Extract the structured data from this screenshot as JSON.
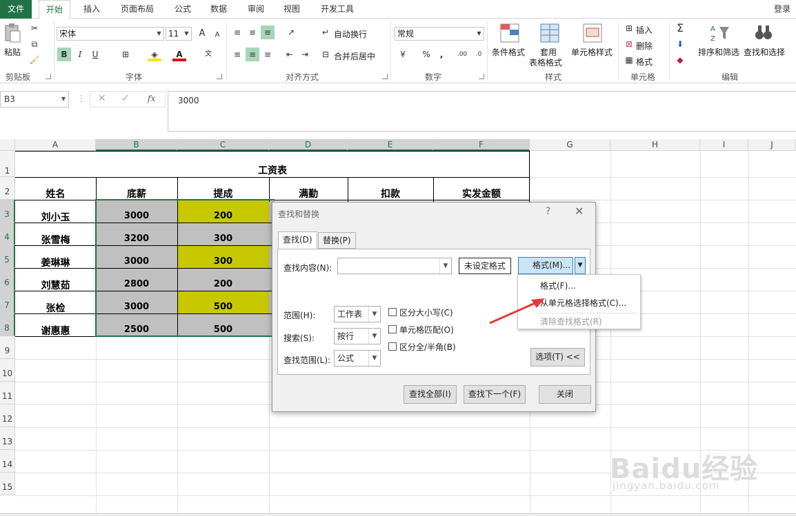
{
  "tabs": {
    "file": "文件",
    "items": [
      "开始",
      "插入",
      "页面布局",
      "公式",
      "数据",
      "审阅",
      "视图",
      "开发工具"
    ],
    "active": "开始",
    "login": "登录"
  },
  "ribbon": {
    "clipboard": {
      "paste": "粘贴",
      "label": "剪贴板"
    },
    "font": {
      "name": "宋体",
      "size": "11",
      "label": "字体",
      "bold": "B",
      "italic": "I",
      "underline": "U",
      "grow": "A",
      "shrink": "A"
    },
    "alignment": {
      "wrap": "自动换行",
      "merge": "合并后居中",
      "label": "对齐方式"
    },
    "number": {
      "format": "常规",
      "percent": "%",
      "comma": ",",
      "label": "数字"
    },
    "styles": {
      "conditional": "条件格式",
      "table": "套用",
      "table2": "表格格式",
      "cell": "单元格样式",
      "label": "样式"
    },
    "cells": {
      "insert": "插入",
      "delete": "删除",
      "format": "格式",
      "label": "单元格"
    },
    "editing": {
      "sort": "排序和筛选",
      "find": "查找和选择",
      "label": "编辑"
    }
  },
  "formula_bar": {
    "name_box": "B3",
    "fx": "fx",
    "content": "3000"
  },
  "sheet": {
    "columns": [
      "A",
      "B",
      "C",
      "D",
      "E",
      "F",
      "G",
      "H",
      "I",
      "J"
    ],
    "rows": [
      "1",
      "2",
      "3",
      "4",
      "5",
      "6",
      "7",
      "8",
      "9",
      "10",
      "11",
      "12",
      "13",
      "14",
      "15"
    ],
    "title": "工资表",
    "headers": [
      "姓名",
      "底薪",
      "提成",
      "满勤",
      "扣款",
      "实发金额"
    ],
    "data": [
      {
        "name": "刘小玉",
        "base": "3000",
        "bonus": "200"
      },
      {
        "name": "张雪梅",
        "base": "3200",
        "bonus": "300"
      },
      {
        "name": "姜琳琳",
        "base": "3000",
        "bonus": "300"
      },
      {
        "name": "刘慧茹",
        "base": "2800",
        "bonus": "200"
      },
      {
        "name": "张检",
        "base": "3000",
        "bonus": "500"
      },
      {
        "name": "谢惠惠",
        "base": "2500",
        "bonus": "500"
      }
    ],
    "colors": {
      "gray": "#c0c0c0",
      "yellow": "#c8c800",
      "accent": "#217346"
    }
  },
  "dialog": {
    "title": "查找和替换",
    "help": "?",
    "close_x": "✕",
    "tab_find": "查找(D)",
    "tab_replace": "替换(P)",
    "find_label": "查找内容(N):",
    "find_value": "",
    "no_format": "未设定格式",
    "format_btn": "格式(M)...",
    "scope_label": "范围(H):",
    "scope_value": "工作表",
    "search_label": "搜索(S):",
    "search_value": "按行",
    "lookin_label": "查找范围(L):",
    "lookin_value": "公式",
    "match_case": "区分大小写(C)",
    "match_cell": "单元格匹配(O)",
    "match_width": "区分全/半角(B)",
    "options_btn": "选项(T) <<",
    "find_all": "查找全部(I)",
    "find_next": "查找下一个(F)",
    "close": "关闭"
  },
  "menu": {
    "items": [
      "格式(F)...",
      "从单元格选择格式(C)...",
      "清除查找格式(R)"
    ]
  },
  "watermark": {
    "brand": "Baidu经验",
    "url": "jingyan.baidu.com"
  }
}
